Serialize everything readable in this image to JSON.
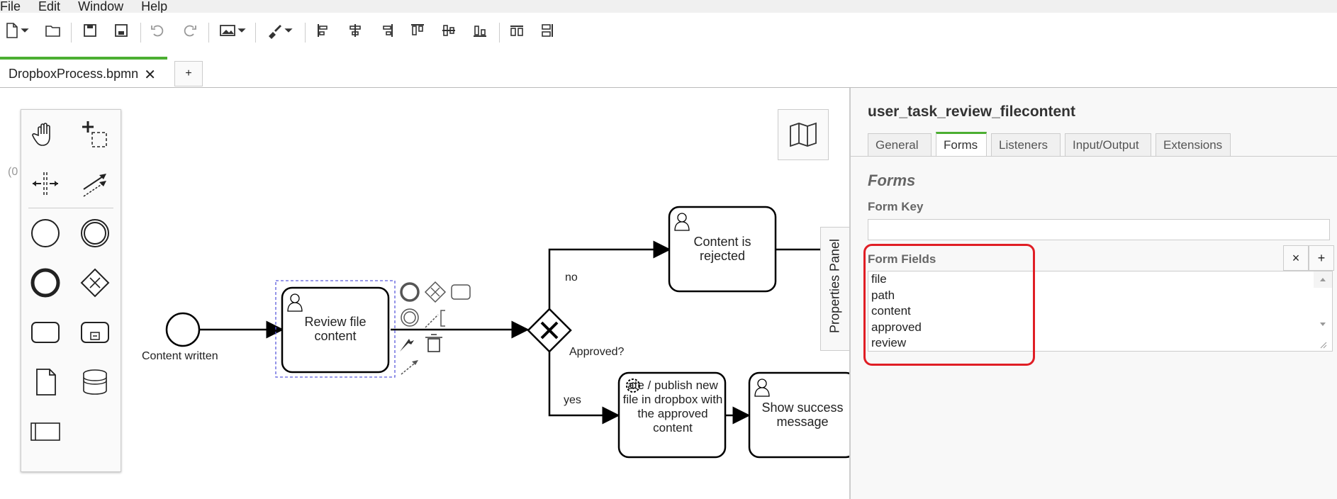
{
  "menu": [
    "File",
    "Edit",
    "Window",
    "Help"
  ],
  "file_tab": {
    "label": "DropboxProcess.bpmn",
    "close": "✕",
    "add": "+"
  },
  "canvas_coord_hint": "(0",
  "diagram": {
    "start_event_label": "Content written",
    "task_review": "Review file content",
    "task_reject": "Content is rejected",
    "task_publish": "Create / publish new file in dropbox with the approved content",
    "task_publish_visible": "ate / publish new file in dropbox with the approved content",
    "task_success": "Show success message",
    "gateway_label": "Approved?",
    "flow_no": "no",
    "flow_yes": "yes"
  },
  "properties_toggle": "Properties Panel",
  "panel": {
    "title": "user_task_review_filecontent",
    "tabs": [
      "General",
      "Forms",
      "Listeners",
      "Input/Output",
      "Extensions"
    ],
    "active_tab": "Forms",
    "section": "Forms",
    "form_key_label": "Form Key",
    "form_key_value": "",
    "form_fields_label": "Form Fields",
    "remove": "×",
    "add": "+",
    "form_fields": [
      "file",
      "path",
      "content",
      "approved",
      "review"
    ]
  },
  "colors": {
    "accent": "#4caf32",
    "highlight": "#e01e25",
    "selection": "#5a5adc"
  }
}
